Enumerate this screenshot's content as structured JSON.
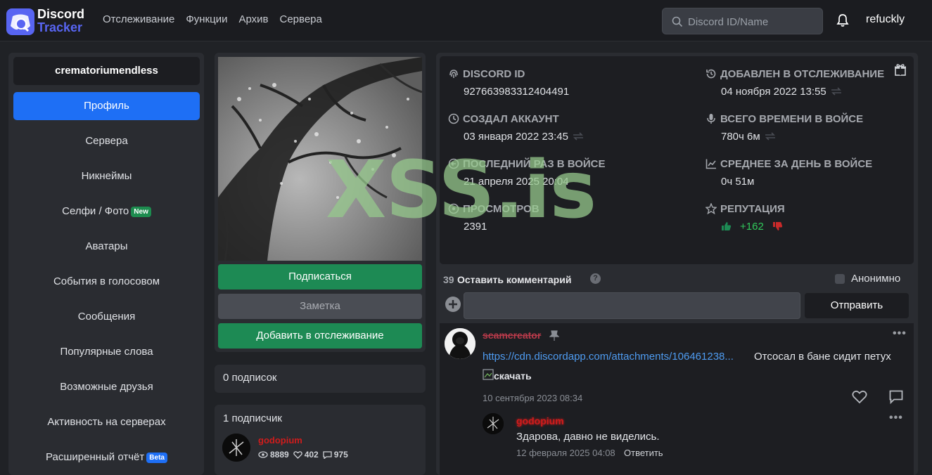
{
  "header": {
    "logo_line1": "Discord",
    "logo_line2": "Tracker",
    "nav": [
      "Отслеживание",
      "Функции",
      "Архив",
      "Сервера"
    ],
    "search_placeholder": "Discord ID/Name",
    "username": "refuckly"
  },
  "sidebar": {
    "title": "crematoriumendless",
    "items": [
      {
        "label": "Профиль",
        "active": true
      },
      {
        "label": "Сервера"
      },
      {
        "label": "Никнеймы"
      },
      {
        "label": "Селфи / Фото",
        "badge": "New"
      },
      {
        "label": "Аватары"
      },
      {
        "label": "События в голосовом"
      },
      {
        "label": "Сообщения"
      },
      {
        "label": "Популярные слова"
      },
      {
        "label": "Возможные друзья"
      },
      {
        "label": "Активность на серверах"
      },
      {
        "label": "Расширенный отчёт",
        "badge": "Beta"
      }
    ]
  },
  "profile": {
    "subscribe_label": "Подписаться",
    "note_label": "Заметка",
    "track_label": "Добавить в отслеживание",
    "subscriptions": "0 подписок",
    "subscribers": "1 подписчик",
    "subscriber": {
      "name": "godopium",
      "views": "8889",
      "likes": "402",
      "comments": "975"
    }
  },
  "info": {
    "discord_id_label": "DISCORD ID",
    "discord_id": "927663983312404491",
    "created_label": "СОЗДАЛ АККАУНТ",
    "created": "03 января 2022 23:45",
    "last_voice_label": "ПОСЛЕДНИЙ РАЗ В ВОЙСЕ",
    "last_voice": "21 апреля 2025 20:04",
    "views_label": "ПРОСМОТРОВ",
    "views": "2391",
    "added_label": "ДОБАВЛЕН В ОТСЛЕЖИВАНИЕ",
    "added": "04 ноября 2022 13:55",
    "voice_total_label": "ВСЕГО ВРЕМЕНИ В ВОЙСЕ",
    "voice_total": "780ч 6м",
    "avg_label": "СРЕДНЕЕ ЗА ДЕНЬ В ВОЙСЕ",
    "avg": "0ч 51м",
    "reputation_label": "РЕПУТАЦИЯ",
    "reputation": "+162"
  },
  "watermark": "XSS.is",
  "comment_form": {
    "count": "39",
    "title": "Оставить комментарий",
    "anon_label": "Анонимно",
    "send_label": "Отправить"
  },
  "comments": [
    {
      "user": "scamcreator",
      "link": "https://cdn.discordapp.com/attachments/106461238...",
      "text": "Отсосал в бане сидит петух",
      "image_alt": "скачать",
      "date": "10 сентября 2023 08:34"
    },
    {
      "user": "godopium",
      "text": "Здарова, давно не виделись.",
      "date": "12 февраля 2025 04:08",
      "reply_label": "Ответить"
    }
  ]
}
